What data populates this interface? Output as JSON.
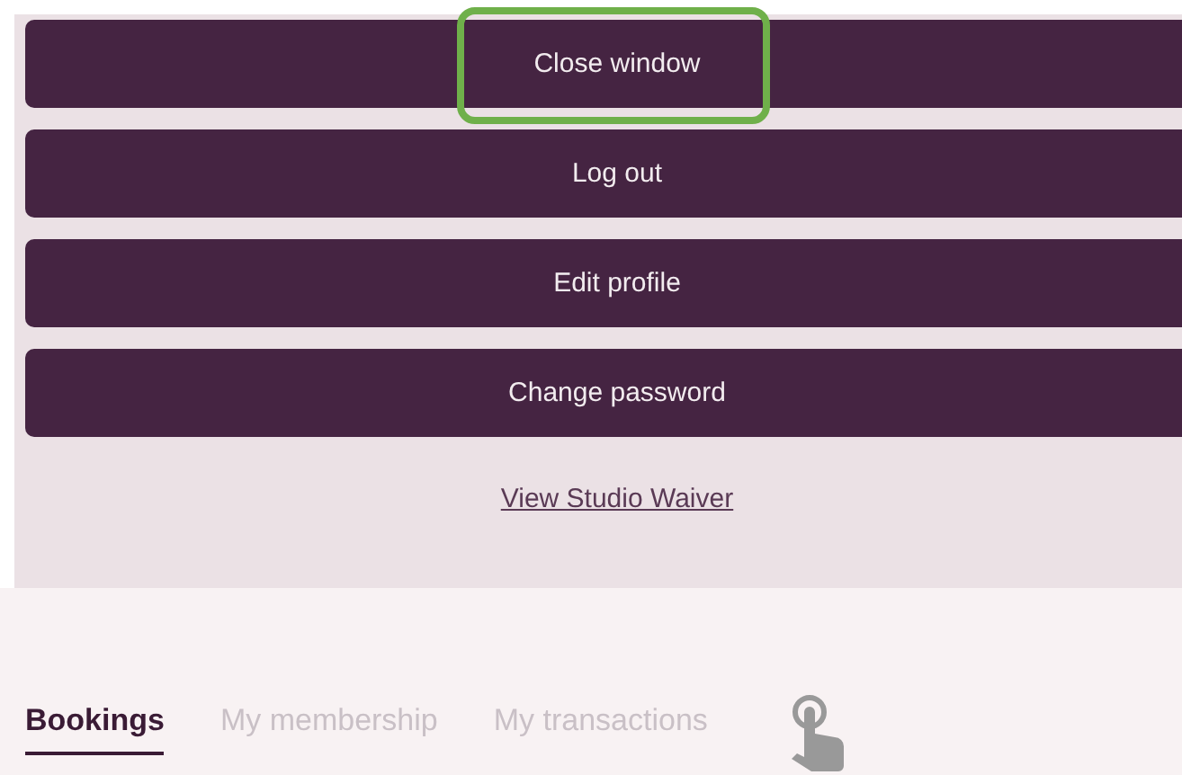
{
  "buttons": [
    {
      "label": "Close window",
      "highlighted": true
    },
    {
      "label": "Log out",
      "highlighted": false
    },
    {
      "label": "Edit profile",
      "highlighted": false
    },
    {
      "label": "Change password",
      "highlighted": false
    }
  ],
  "waiver_link": "View Studio Waiver",
  "tabs": [
    {
      "label": "Bookings",
      "selected": true
    },
    {
      "label": "My membership",
      "selected": false
    },
    {
      "label": "My transactions",
      "selected": false
    }
  ]
}
